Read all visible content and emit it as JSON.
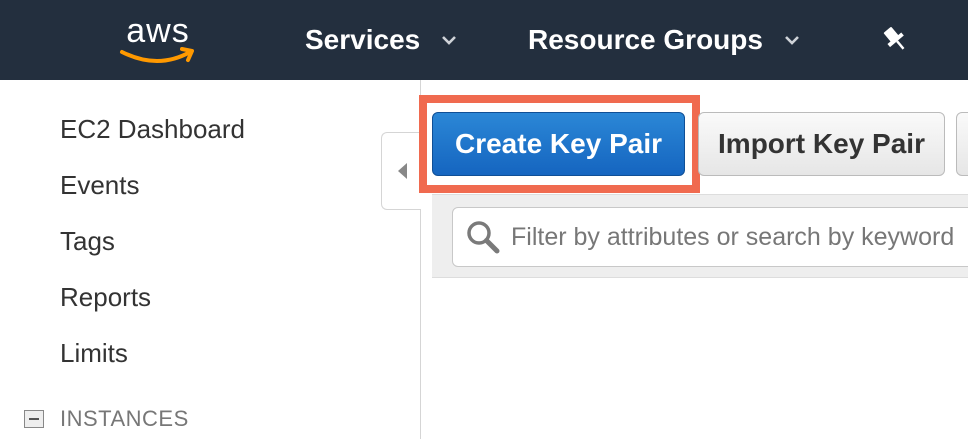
{
  "header": {
    "logo_text": "aws",
    "nav": [
      {
        "label": "Services"
      },
      {
        "label": "Resource Groups"
      }
    ],
    "colors": {
      "bar": "#232f3e",
      "smile": "#f90"
    }
  },
  "sidebar": {
    "items": [
      {
        "label": "EC2 Dashboard"
      },
      {
        "label": "Events"
      },
      {
        "label": "Tags"
      },
      {
        "label": "Reports"
      },
      {
        "label": "Limits"
      }
    ],
    "section": {
      "label": "INSTANCES",
      "icon": "minus-box-icon"
    }
  },
  "toolbar": {
    "create_label": "Create Key Pair",
    "import_label": "Import Key Pair",
    "highlight_color": "#f06a4f"
  },
  "search": {
    "placeholder": "Filter by attributes or search by keyword",
    "value": ""
  }
}
